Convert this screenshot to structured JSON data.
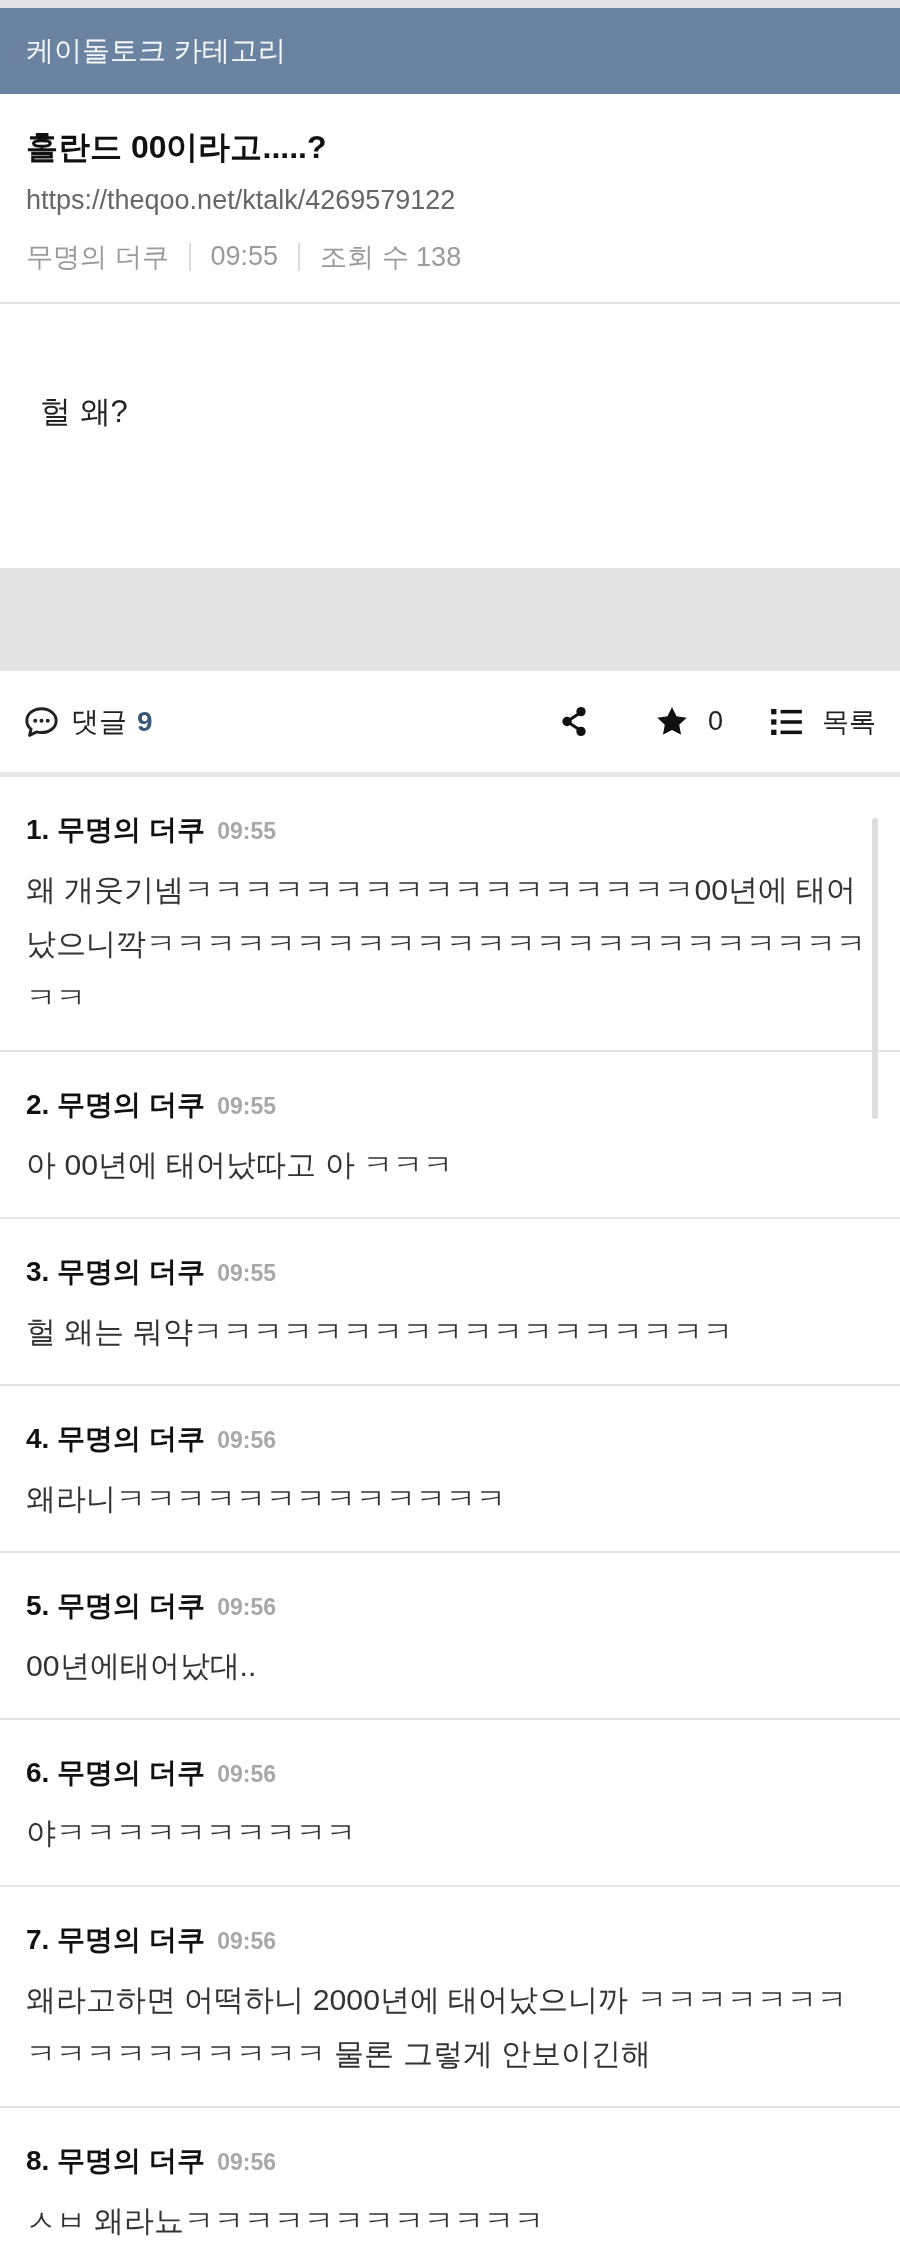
{
  "category_bar": {
    "title": "케이돌토크 카테고리"
  },
  "post": {
    "title": "홀란드 00이라고.....?",
    "url": "https://theqoo.net/ktalk/4269579122",
    "author": "무명의 더쿠",
    "time": "09:55",
    "views": "조회 수 138",
    "body": "헐 왜?"
  },
  "toolbar": {
    "comments_label": "댓글",
    "comment_count": "9",
    "star_count": "0",
    "list_label": "목록"
  },
  "comments": [
    {
      "number": "1.",
      "author": "무명의 더쿠",
      "time": "09:55",
      "text": "왜 개웃기넴ㅋㅋㅋㅋㅋㅋㅋㅋㅋㅋㅋㅋㅋㅋㅋㅋㅋ00년에 태어났으니깍ㅋㅋㅋㅋㅋㅋㅋㅋㅋㅋㅋㅋㅋㅋㅋㅋㅋㅋㅋㅋㅋㅋㅋㅋㅋㅋ"
    },
    {
      "number": "2.",
      "author": "무명의 더쿠",
      "time": "09:55",
      "text": "아 00년에 태어났따고 아 ㅋㅋㅋ"
    },
    {
      "number": "3.",
      "author": "무명의 더쿠",
      "time": "09:55",
      "text": "헐 왜는 뭐약ㅋㅋㅋㅋㅋㅋㅋㅋㅋㅋㅋㅋㅋㅋㅋㅋㅋㅋ"
    },
    {
      "number": "4.",
      "author": "무명의 더쿠",
      "time": "09:56",
      "text": "왜라니ㅋㅋㅋㅋㅋㅋㅋㅋㅋㅋㅋㅋㅋ"
    },
    {
      "number": "5.",
      "author": "무명의 더쿠",
      "time": "09:56",
      "text": "00년에태어났대.."
    },
    {
      "number": "6.",
      "author": "무명의 더쿠",
      "time": "09:56",
      "text": "야ㅋㅋㅋㅋㅋㅋㅋㅋㅋㅋ"
    },
    {
      "number": "7.",
      "author": "무명의 더쿠",
      "time": "09:56",
      "text": "왜라고하면 어떡하니 2000년에 태어났으니까 ㅋㅋㅋㅋㅋㅋㅋㅋㅋㅋㅋㅋㅋㅋㅋㅋㅋ 물론 그렇게 안보이긴해"
    },
    {
      "number": "8.",
      "author": "무명의 더쿠",
      "time": "09:56",
      "text": "ㅅㅂ 왜라뇨ㅋㅋㅋㅋㅋㅋㅋㅋㅋㅋㅋㅋ"
    }
  ]
}
